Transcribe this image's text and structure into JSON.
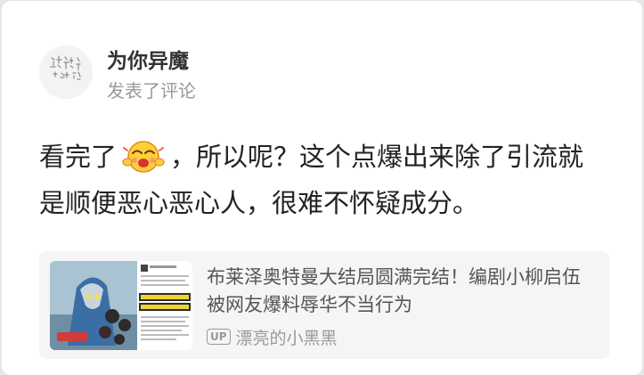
{
  "comment": {
    "user_name": "为你异魔",
    "action": "发表了评论",
    "text_before_emoji": "看完了",
    "emoji_name": "laughing-face-emoji",
    "text_after_emoji": "，所以呢？这个点爆出来除了引流就",
    "text_line2": "是顺便恶心恶心人，很难不怀疑成分。"
  },
  "linked_article": {
    "title": "布莱泽奥特曼大结局圆满完结！编剧小柳启伍被网友爆料辱华不当行为",
    "up_badge": "UP",
    "author": "漂亮的小黑黑"
  },
  "colors": {
    "background": "#e6e6e6",
    "card": "#ffffff",
    "link_card": "#f5f5f5",
    "primary_text": "#222222",
    "secondary_text": "#999999"
  }
}
